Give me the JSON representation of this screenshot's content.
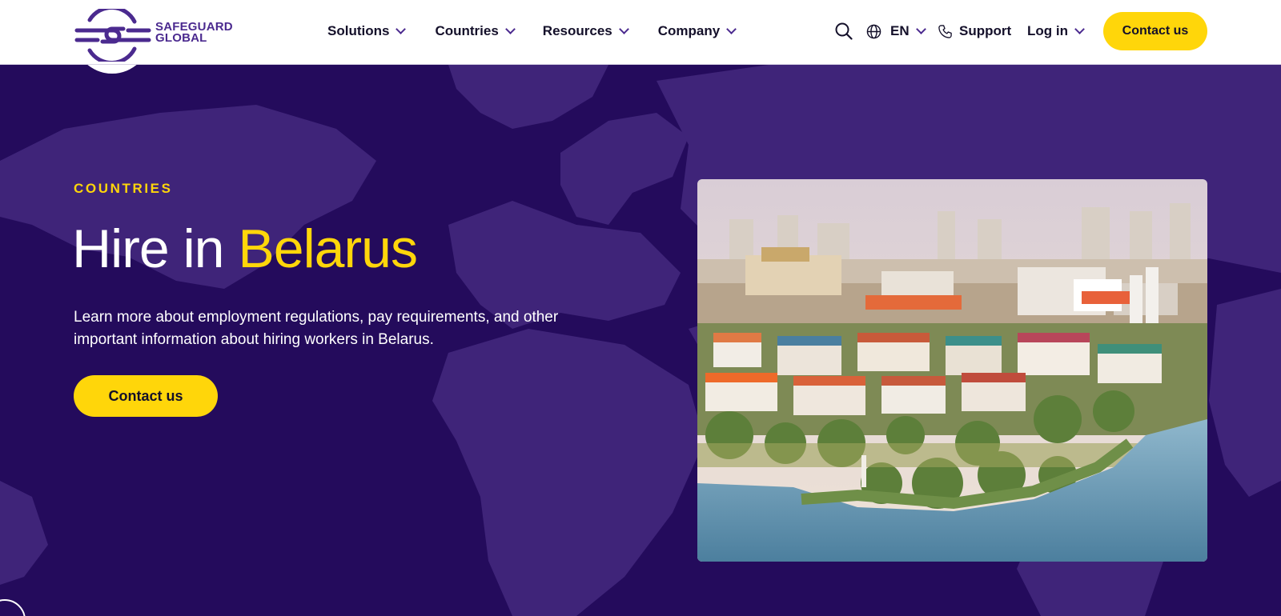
{
  "brand": {
    "line1": "SAFEGUARD",
    "line2": "GLOBAL",
    "color": "#4b2a8f"
  },
  "nav": {
    "items": [
      {
        "label": "Solutions"
      },
      {
        "label": "Countries"
      },
      {
        "label": "Resources"
      },
      {
        "label": "Company"
      }
    ]
  },
  "utility": {
    "search_icon": "search-icon",
    "language": "EN",
    "support": "Support",
    "login": "Log in",
    "contact": "Contact us"
  },
  "hero": {
    "eyebrow": "COUNTRIES",
    "headline_prefix": "Hire in ",
    "headline_highlight": "Belarus",
    "intro": "Learn more about employment regulations, pay requirements, and other important information about hiring workers in Belarus.",
    "cta": "Contact us",
    "image": "aerial-city-riverside-photo"
  },
  "colors": {
    "accent": "#ffd60a",
    "hero_bg": "#240b5c",
    "map_land": "#3f2479",
    "text_dark": "#14102a"
  }
}
